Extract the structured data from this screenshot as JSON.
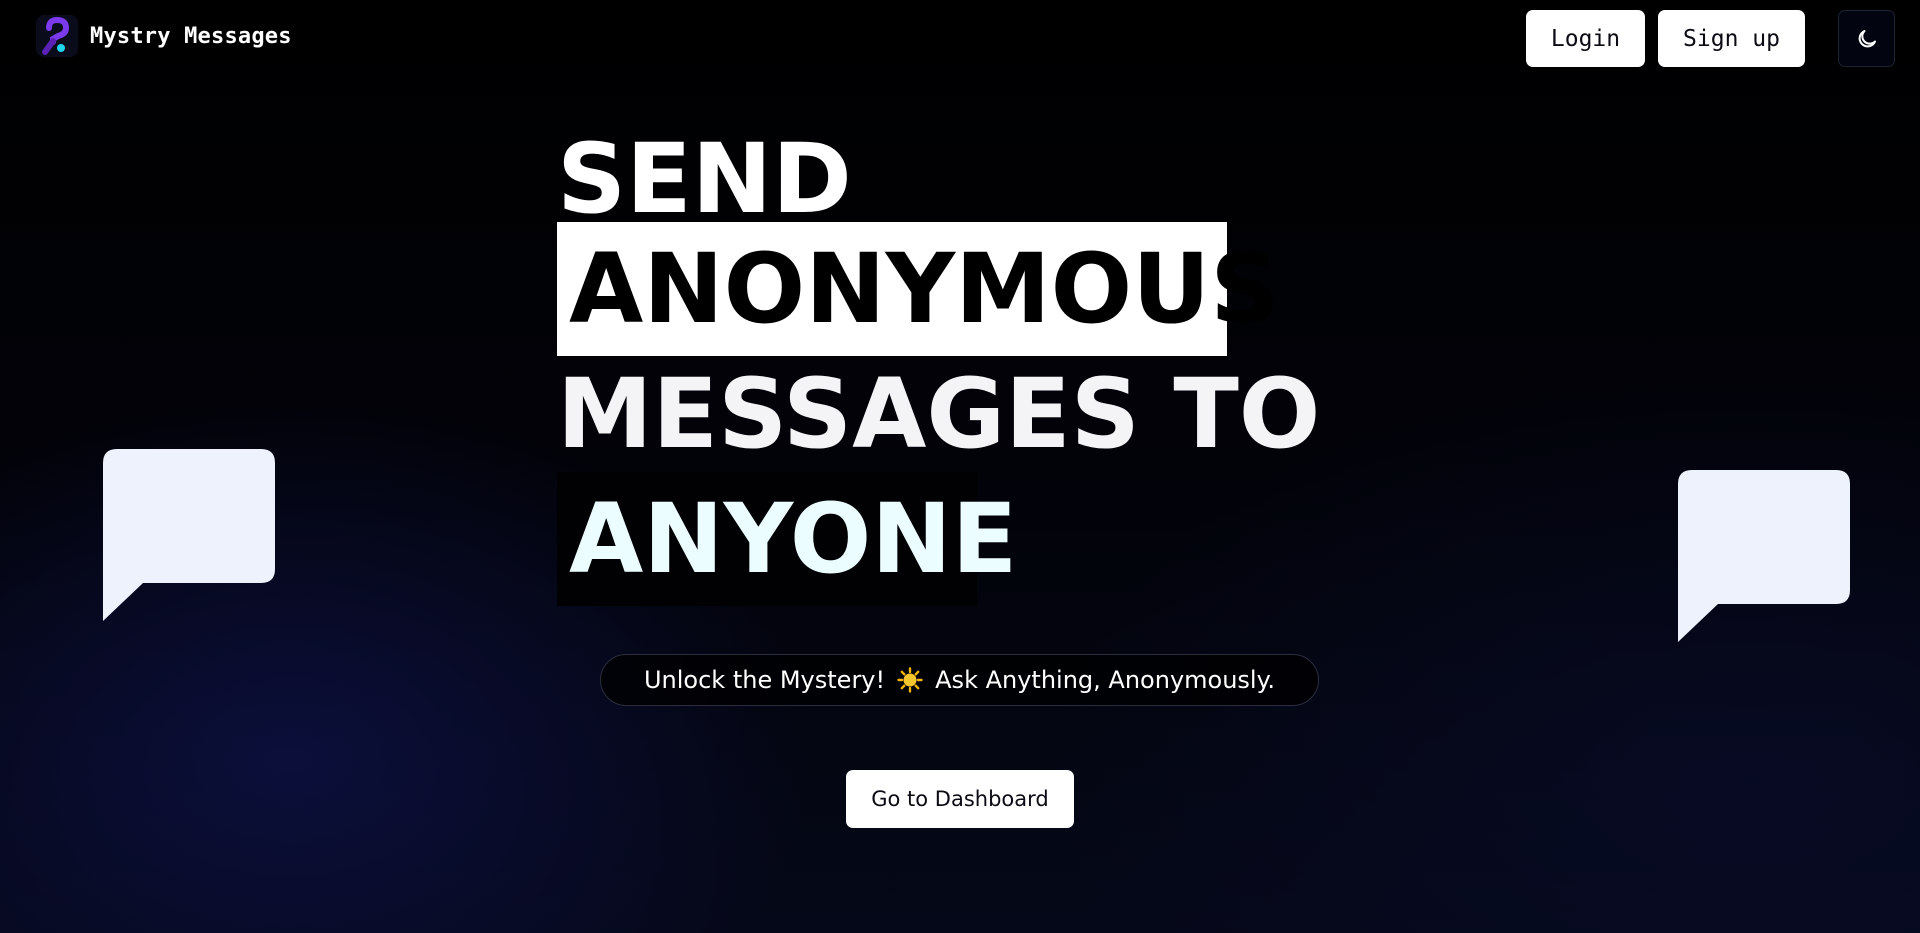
{
  "brand": {
    "name": "Mystry Messages",
    "logo_icon": "question-mark-logo-icon"
  },
  "nav": {
    "login_label": "Login",
    "signup_label": "Sign up",
    "theme_icon": "moon-icon"
  },
  "hero": {
    "line1": "SEND",
    "line2": "ANONYMOUS",
    "line3": "MESSAGES TO",
    "line4": "ANYONE"
  },
  "tagline": {
    "before": "Unlock the Mystery!",
    "emoji": "🌟",
    "after": "Ask Anything, Anonymously."
  },
  "cta": {
    "label": "Go to Dashboard"
  },
  "decor": {
    "left_icon": "speech-bubble-icon",
    "right_icon": "speech-bubble-icon"
  },
  "colors": {
    "background": "#000000",
    "accent_purple": "#6d28d9",
    "accent_cyan": "#22d3ee",
    "button_bg": "#ffffff",
    "bubble_fill": "#eef2fd"
  }
}
